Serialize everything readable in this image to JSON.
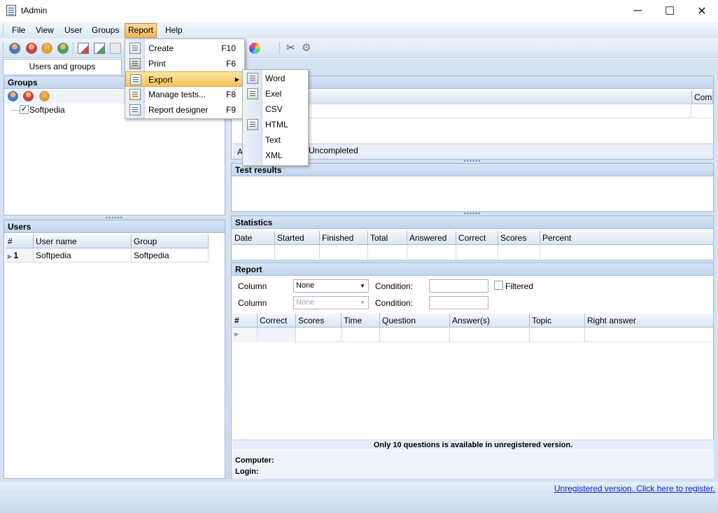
{
  "window": {
    "title": "tAdmin",
    "minimize": "─",
    "maximize": "☐",
    "close": "✕"
  },
  "menubar": [
    "File",
    "View",
    "User",
    "Groups",
    "Report",
    "Help"
  ],
  "left": {
    "tab_label": "Users and groups",
    "groups_header": "Groups",
    "group_items": [
      {
        "label": "Softpedia",
        "checked": true
      }
    ],
    "users_header": "Users",
    "users_columns": [
      "#",
      "User name",
      "Group"
    ],
    "users_rows": [
      {
        "num": "1",
        "name": "Softpedia",
        "group": "Softpedia"
      }
    ]
  },
  "right": {
    "top_partial_header": "Comp",
    "tabs_partial": {
      "a": "A",
      "uncompleted": "Uncompleted"
    },
    "test_results_header": "Test results",
    "statistics_header": "Statistics",
    "statistics_columns": [
      "Date",
      "Started",
      "Finished",
      "Total",
      "Answered",
      "Correct",
      "Scores",
      "Percent"
    ],
    "report_header": "Report",
    "filter_rows": [
      {
        "column_label": "Column",
        "column_value": "None",
        "condition_label": "Condition:",
        "enabled": true
      },
      {
        "column_label": "Column",
        "column_value": "None",
        "condition_label": "Condition:",
        "enabled": false
      }
    ],
    "filtered_label": "Filtered",
    "report_columns": [
      "#",
      "Correct",
      "Scores",
      "Time",
      "Question",
      "Answer(s)",
      "Topic",
      "Right answer"
    ],
    "notice": "Only 10 questions is available in unregistered version.",
    "computer_label": "Computer:",
    "login_label": "Login:"
  },
  "report_menu": [
    {
      "label": "Create",
      "shortcut": "F10",
      "icon": "create-report-icon"
    },
    {
      "label": "Print",
      "shortcut": "F6",
      "icon": "printer-icon"
    },
    {
      "label": "Export",
      "shortcut": "",
      "icon": "export-icon",
      "submenu": true
    },
    {
      "label": "Manage tests...",
      "shortcut": "F8",
      "icon": "manage-tests-icon"
    },
    {
      "label": "Report designer",
      "shortcut": "F9",
      "icon": "report-designer-icon"
    }
  ],
  "export_menu": [
    {
      "label": "Word",
      "icon": "word-icon"
    },
    {
      "label": "Exel",
      "icon": "excel-icon"
    },
    {
      "label": "CSV",
      "icon": ""
    },
    {
      "label": "HTML",
      "icon": "html-icon"
    },
    {
      "label": "Text",
      "icon": ""
    },
    {
      "label": "XML",
      "icon": ""
    }
  ],
  "status": {
    "register_link": "Unregistered version. Click here to register."
  },
  "colors": {
    "accent": "#f8b55a",
    "header": "#c2d5ee",
    "link": "#0a28c8"
  }
}
